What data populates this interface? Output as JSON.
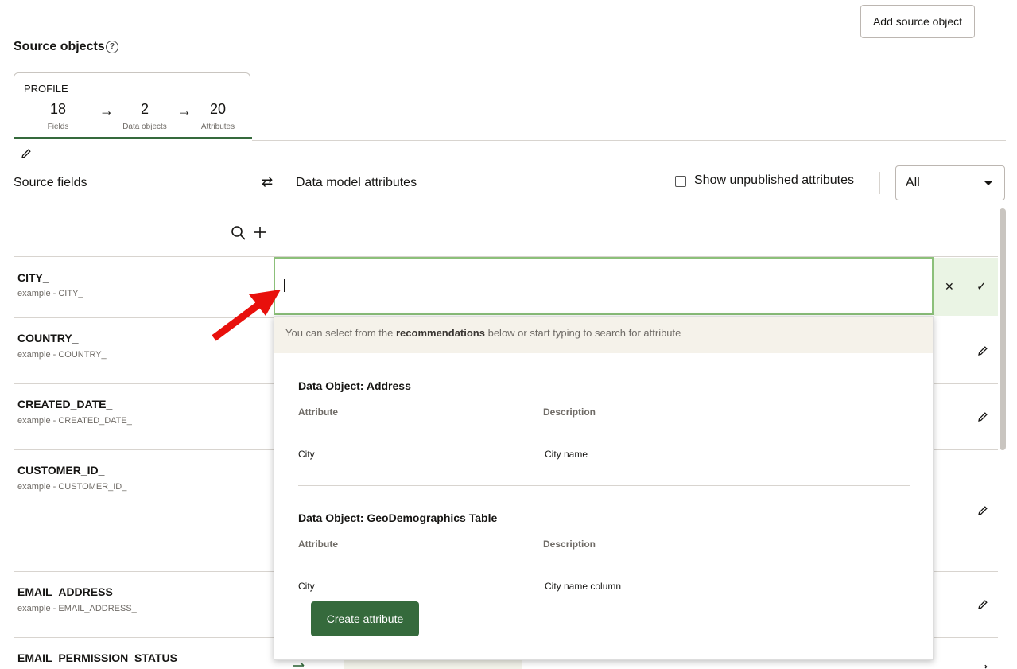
{
  "header": {
    "add_source_label": "Add source object",
    "title": "Source objects",
    "help_glyph": "?"
  },
  "profile_tab": {
    "label": "PROFILE",
    "fields_count": "18",
    "fields_label": "Fields",
    "data_objects_count": "2",
    "data_objects_label": "Data objects",
    "attributes_count": "20",
    "attributes_label": "Attributes",
    "arrow_glyph": "→"
  },
  "mapping_header": {
    "source_fields_label": "Source fields",
    "swap_glyph": "⇄",
    "data_model_label": "Data model attributes",
    "show_unpublished_label": "Show unpublished attributes",
    "filter_value": "All"
  },
  "rows": [
    {
      "name": "CITY_",
      "example": "example - CITY_"
    },
    {
      "name": "COUNTRY_",
      "example": "example - COUNTRY_"
    },
    {
      "name": "CREATED_DATE_",
      "example": "example - CREATED_DATE_"
    },
    {
      "name": "CUSTOMER_ID_",
      "example": "example - CUSTOMER_ID_"
    },
    {
      "name": "EMAIL_ADDRESS_",
      "example": "example - EMAIL_ADDRESS_"
    },
    {
      "name": "EMAIL_PERMISSION_STATUS_",
      "example": ""
    }
  ],
  "editor": {
    "cancel_glyph": "✕",
    "confirm_glyph": "✓"
  },
  "dropdown": {
    "hint_prefix": "You can select from the ",
    "hint_bold": "recommendations",
    "hint_suffix": " below or start typing to search for attribute",
    "groups": [
      {
        "title": "Data Object: Address",
        "col_attribute": "Attribute",
        "col_description": "Description",
        "attribute": "City",
        "description": "City name"
      },
      {
        "title": "Data Object: GeoDemographics Table",
        "col_attribute": "Attribute",
        "col_description": "Description",
        "attribute": "City",
        "description": "City name column"
      }
    ],
    "create_label": "Create attribute"
  },
  "colors": {
    "accent": "#356a3c",
    "focus_border": "#8cc07a",
    "annotation_arrow": "#e8100c"
  }
}
